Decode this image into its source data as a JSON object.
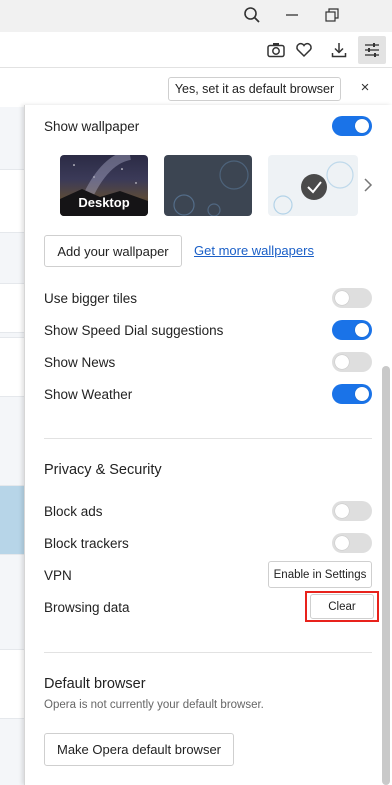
{
  "titlebar": {
    "search_icon": "search-icon",
    "minimize_icon": "minimize-icon",
    "restore_icon": "restore-icon"
  },
  "toolbar": {
    "icons": [
      "camera-icon",
      "heart-icon",
      "download-icon",
      "easy-setup-icon"
    ]
  },
  "infobar": {
    "default_browser_label": "Yes, set it as default browser",
    "close_glyph": "×"
  },
  "settings": {
    "show_wallpaper": {
      "label": "Show wallpaper",
      "on": true
    },
    "wallpapers": [
      {
        "label": "Desktop",
        "selected": false
      },
      {
        "label": "",
        "selected": false
      },
      {
        "label": "",
        "selected": true
      }
    ],
    "add_wallpaper_label": "Add your wallpaper",
    "more_wallpapers_label": "Get more wallpapers",
    "toggles": [
      {
        "label": "Use bigger tiles",
        "on": false
      },
      {
        "label": "Show Speed Dial suggestions",
        "on": true
      },
      {
        "label": "Show News",
        "on": false
      },
      {
        "label": "Show Weather",
        "on": true
      }
    ],
    "privacy": {
      "title": "Privacy & Security",
      "block_ads": {
        "label": "Block ads",
        "on": false
      },
      "block_trackers": {
        "label": "Block trackers",
        "on": false
      },
      "vpn_label": "VPN",
      "vpn_button": "Enable in Settings",
      "browsing_data_label": "Browsing data",
      "clear_button": "Clear"
    },
    "default_browser": {
      "title": "Default browser",
      "subtitle": "Opera is not currently your default browser.",
      "button": "Make Opera default browser"
    }
  },
  "colors": {
    "accent": "#1a73e8",
    "highlight": "#e8221c"
  }
}
